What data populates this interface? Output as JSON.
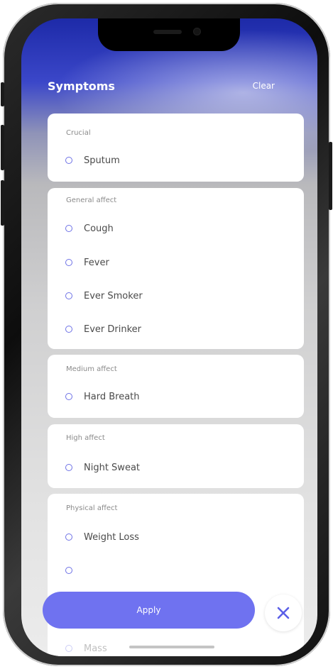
{
  "header": {
    "title": "Symptoms",
    "clear_label": "Clear"
  },
  "groups": [
    {
      "label": "Crucial",
      "items": [
        "Sputum"
      ]
    },
    {
      "label": "General affect",
      "items": [
        "Cough",
        "Fever",
        "Ever Smoker",
        "Ever Drinker"
      ]
    },
    {
      "label": "Medium affect",
      "items": [
        "Hard Breath"
      ]
    },
    {
      "label": "High affect",
      "items": [
        "Night Sweat"
      ]
    },
    {
      "label": "Physical affect",
      "items": [
        "Weight Loss",
        "",
        "Mass"
      ]
    }
  ],
  "footer": {
    "apply_label": "Apply",
    "close_icon": "close-icon"
  },
  "colors": {
    "accent": "#6f72f0",
    "header_blue": "#1d2aa8",
    "radio": "#6e72e6"
  }
}
